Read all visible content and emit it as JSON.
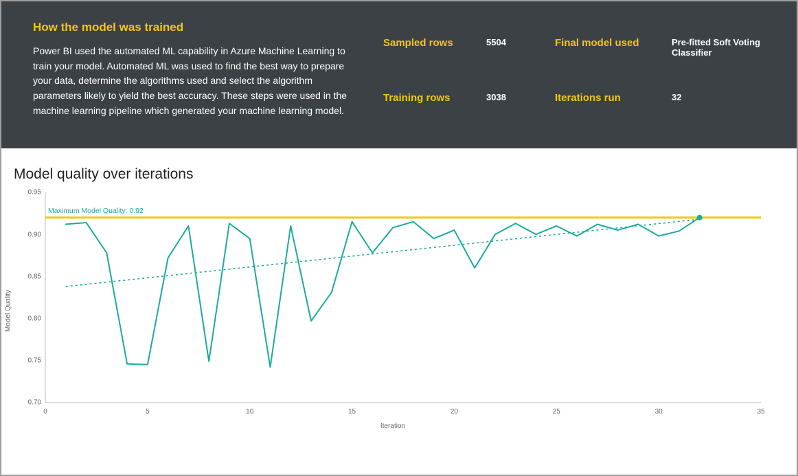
{
  "header": {
    "title": "How the model was trained",
    "body": "Power BI used the automated ML capability in Azure Machine Learning to train your model. Automated ML was used to find the best way to prepare your data, determine the algorithms used and select the algorithm parameters likely to yield the best accuracy. These steps were used in the machine learning pipeline which generated your machine learning model.",
    "stats": {
      "sampled_rows": {
        "label": "Sampled rows",
        "value": "5504"
      },
      "training_rows": {
        "label": "Training rows",
        "value": "3038"
      },
      "final_model": {
        "label": "Final model used",
        "value": "Pre-fitted Soft Voting Classifier"
      },
      "iterations": {
        "label": "Iterations run",
        "value": "32"
      }
    }
  },
  "chart": {
    "title": "Model quality over iterations",
    "ylabel": "Model Quality",
    "xlabel": "Iteration",
    "max_line_label": "Maximum Model Quality: 0.92"
  },
  "chart_data": {
    "type": "line",
    "title": "Model quality over iterations",
    "xlabel": "Iteration",
    "ylabel": "Model Quality",
    "xlim": [
      0,
      35
    ],
    "ylim": [
      0.7,
      0.95
    ],
    "y_ticks": [
      0.7,
      0.75,
      0.8,
      0.85,
      0.9,
      0.95
    ],
    "x_ticks": [
      0,
      5,
      10,
      15,
      20,
      25,
      30,
      35
    ],
    "max_quality": 0.92,
    "x": [
      1,
      2,
      3,
      4,
      5,
      6,
      7,
      8,
      9,
      10,
      11,
      12,
      13,
      14,
      15,
      16,
      17,
      18,
      19,
      20,
      21,
      22,
      23,
      24,
      25,
      26,
      27,
      28,
      29,
      30,
      31,
      32
    ],
    "values": [
      0.912,
      0.914,
      0.878,
      0.746,
      0.745,
      0.872,
      0.91,
      0.749,
      0.913,
      0.895,
      0.742,
      0.91,
      0.797,
      0.831,
      0.915,
      0.878,
      0.908,
      0.915,
      0.895,
      0.905,
      0.86,
      0.9,
      0.913,
      0.9,
      0.91,
      0.898,
      0.912,
      0.905,
      0.912,
      0.898,
      0.904,
      0.92
    ],
    "trend": {
      "x": [
        1,
        32
      ],
      "y": [
        0.838,
        0.918
      ]
    },
    "colors": {
      "series": "#1aab9b",
      "trend": "#1aab9b",
      "max_line": "#f2c811"
    }
  }
}
